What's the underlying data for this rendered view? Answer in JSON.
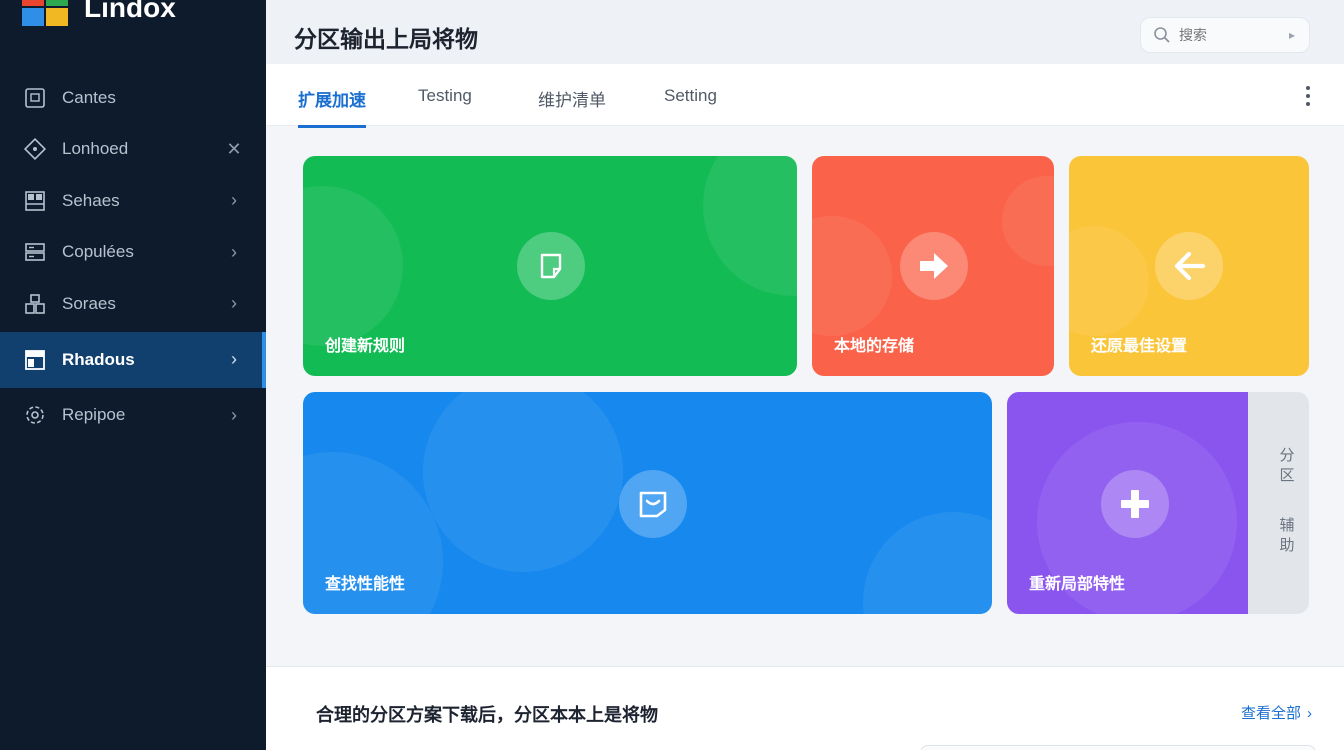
{
  "brand": {
    "name": "Lindox"
  },
  "sidebar": {
    "items": [
      {
        "label": "Cantes",
        "icon": "square-icon",
        "trailing": ""
      },
      {
        "label": "Lonhoed",
        "icon": "diamond-icon",
        "trailing": "✕"
      },
      {
        "label": "Sehaes",
        "icon": "grid-icon",
        "trailing": "›"
      },
      {
        "label": "Copulées",
        "icon": "server-icon",
        "trailing": "›"
      },
      {
        "label": "Soraes",
        "icon": "apps-icon",
        "trailing": "›"
      },
      {
        "label": "Rhadous",
        "icon": "layout-icon",
        "trailing": "›",
        "active": true
      },
      {
        "label": "Repipoe",
        "icon": "gear-icon",
        "trailing": "›"
      }
    ]
  },
  "header": {
    "title": "分区输出上局将物"
  },
  "search": {
    "placeholder": "搜索"
  },
  "tabs": [
    {
      "label": "扩展加速",
      "active": true
    },
    {
      "label": "Testing"
    },
    {
      "label": "维护清单"
    },
    {
      "label": "Setting"
    }
  ],
  "tiles": [
    {
      "label": "创建新规则",
      "color": "#13bb55",
      "icon": "note-icon"
    },
    {
      "label": "本地的存储",
      "color": "#fa6249",
      "icon": "arrow-right-icon"
    },
    {
      "label": "还原最佳设置",
      "color": "#fbc53a",
      "icon": "arrow-left-icon"
    },
    {
      "label": "查找性能性",
      "color": "#1688ee",
      "icon": "frame-icon"
    },
    {
      "label": "重新局部特性",
      "color": "#8a55ef",
      "icon": "plus-icon"
    }
  ],
  "side_panel": {
    "line1": "分区",
    "line2": "辅助"
  },
  "bottom": {
    "title": "合理的分区方案下载后，分区本本上是将物",
    "link": "查看全部"
  }
}
